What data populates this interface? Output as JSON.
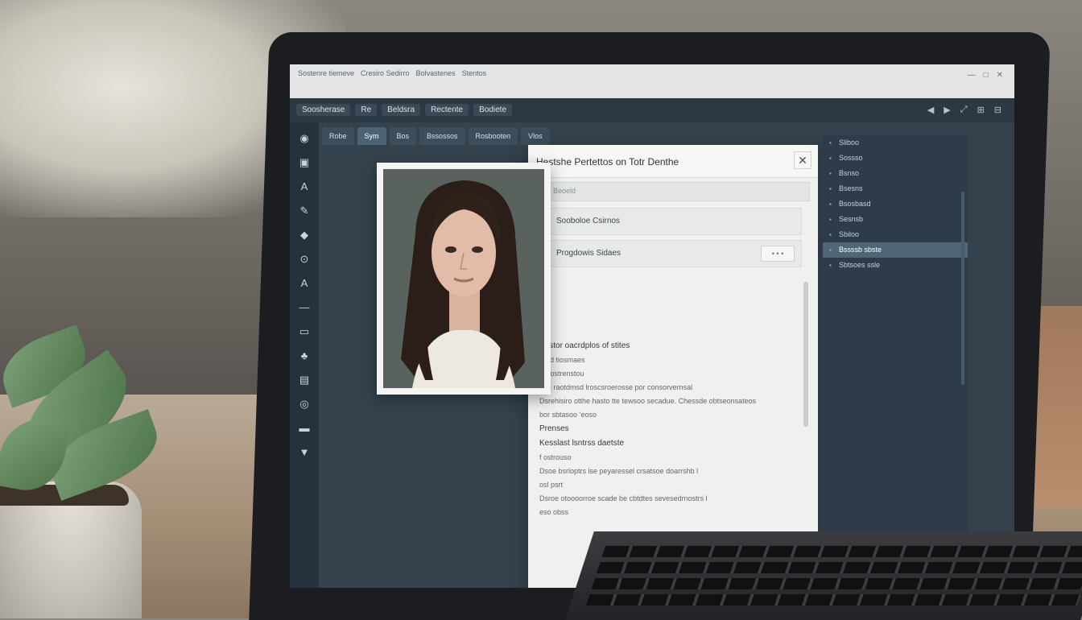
{
  "window": {
    "title_tabs": [
      "Sostenre tiemeve",
      "Cresiro Sedirro",
      "Bolvastenes",
      "Stentos"
    ],
    "controls": [
      "—",
      "□",
      "✕"
    ]
  },
  "menubar": {
    "items": [
      "Soosherase",
      "Re",
      "Beldsra",
      "Rectente",
      "Bodiete"
    ],
    "right_icons": [
      "◀",
      "▶",
      "⤢",
      "⊞",
      "⊟"
    ]
  },
  "tabs": [
    "Robe",
    "Sym",
    "Bos",
    "Bssossos",
    "Rosbooten",
    "Vlos"
  ],
  "leftbar_icons": [
    "◉",
    "▣",
    "A",
    "✎",
    "◆",
    "⊙",
    "A",
    "—",
    "▭",
    "♣",
    "▤",
    "◎",
    "▬",
    "▼"
  ],
  "dialog": {
    "title": "Hestshe Pertettos on Totr Denthe",
    "close": "✕",
    "search_placeholder": "Beoeld",
    "section1": {
      "label": "Sooboloe Csirnos",
      "action": ""
    },
    "section2": {
      "label": "Progdowis Sidaes",
      "action": "• • •"
    },
    "list": [
      {
        "text": "Sostor oacrdplos of stites",
        "head": true
      },
      {
        "text": "Paid tiosmaes",
        "head": false
      },
      {
        "text": "An ostrenstou",
        "head": false
      },
      {
        "text": "Psc raotdmsd lroscsroerosse por consorvernsal",
        "head": false
      },
      {
        "text": "Dsrehisiro otthe hasto tte tewsoo secadue. Chessde obtseonsateos",
        "head": false
      },
      {
        "text": "bor sbtasoo ‘eoso",
        "head": false
      },
      {
        "text": "Prenses",
        "head": true
      },
      {
        "text": "Kesslast lsntrss daetste",
        "head": true
      },
      {
        "text": "f ostrouso",
        "head": false
      },
      {
        "text": "Dsoe bsrloptrs lse peyaressel crsatsoe doarrshb l",
        "head": false
      },
      {
        "text": "osl psrt",
        "head": false
      },
      {
        "text": "Dsroe otoooorroe scade be cbtdtes sevesedrnostrs l",
        "head": false
      },
      {
        "text": "eso obss",
        "head": false
      }
    ]
  },
  "right_panel": {
    "items": [
      "Sliboo",
      "Sossso",
      "Bsnso",
      "Bsesns",
      "Bsosbasd",
      "Sesnsb",
      "Sbiloo",
      "Bssssb sbste",
      "Sbtsoes ssle"
    ],
    "selected_index": 7
  },
  "accent": "#4f6676"
}
